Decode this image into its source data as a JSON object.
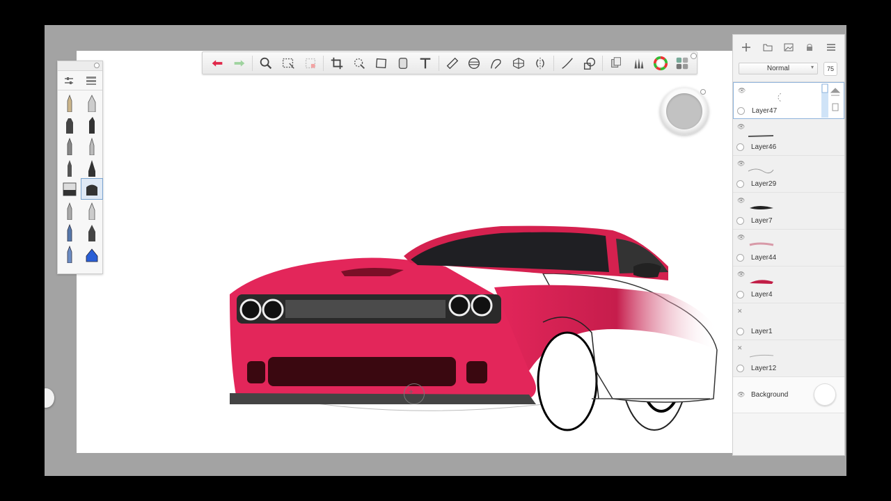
{
  "app": {
    "toolbar_icons": [
      "undo-icon",
      "redo-icon",
      "zoom-icon",
      "select-rect-icon",
      "select-clear-icon",
      "crop-icon",
      "transform-icon",
      "distort-icon",
      "fill-icon",
      "text-icon",
      "ruler-icon",
      "ellipse-guide-icon",
      "french-curve-icon",
      "perspective-icon",
      "symmetry-icon",
      "stroke-icon",
      "shape-icon",
      "copic-icon",
      "brush-set-icon",
      "color-wheel-icon",
      "ui-layout-icon"
    ],
    "accent": "#e0284a"
  },
  "layers": {
    "blend_mode": "Normal",
    "opacity": "75",
    "items": [
      {
        "name": "Layer47",
        "selected": true,
        "hidden": false
      },
      {
        "name": "Layer46",
        "selected": false,
        "hidden": false
      },
      {
        "name": "Layer29",
        "selected": false,
        "hidden": false
      },
      {
        "name": "Layer7",
        "selected": false,
        "hidden": false
      },
      {
        "name": "Layer44",
        "selected": false,
        "hidden": false
      },
      {
        "name": "Layer4",
        "selected": false,
        "hidden": false
      },
      {
        "name": "Layer1",
        "selected": false,
        "hidden": true
      },
      {
        "name": "Layer12",
        "selected": false,
        "hidden": true
      }
    ],
    "background_label": "Background"
  },
  "brush_panel": {
    "brushes": [
      "pencil",
      "felt-pen",
      "marker",
      "chisel",
      "ballpoint",
      "airbrush",
      "fine-liner",
      "needle",
      "block-eraser",
      "soft-eraser",
      "paint-brush",
      "smudge",
      "technical-pen",
      "flat-brush",
      "ink-pen",
      "fill-bucket"
    ]
  }
}
